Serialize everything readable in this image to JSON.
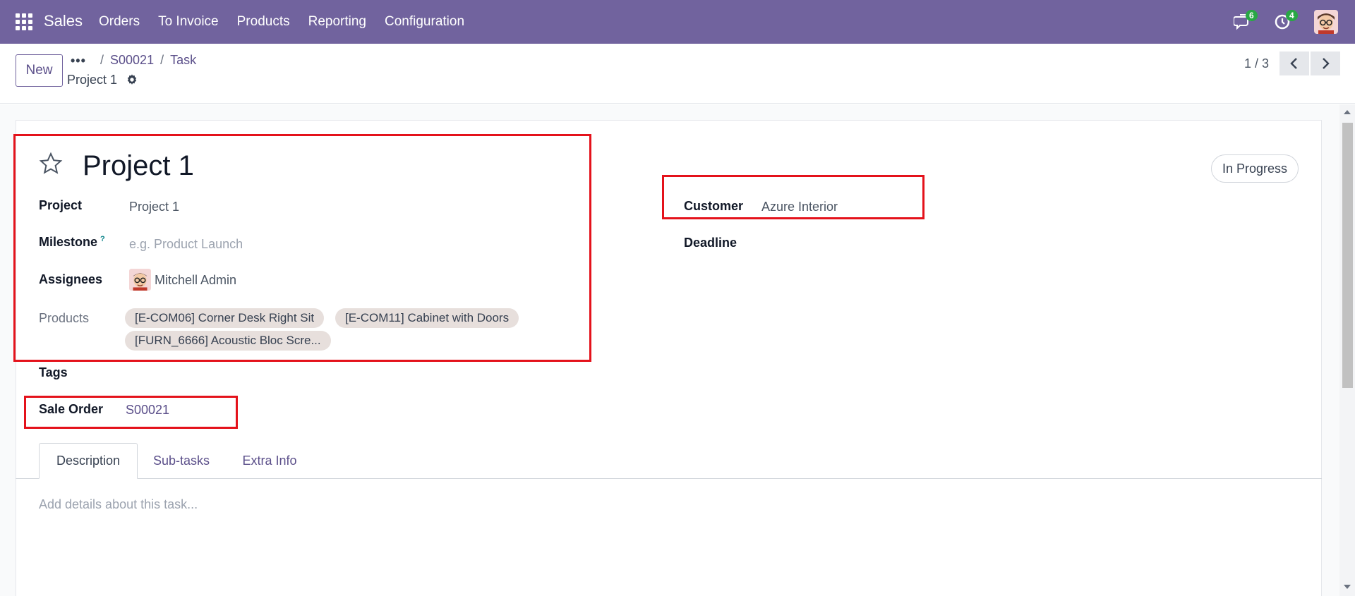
{
  "navbar": {
    "app_name": "Sales",
    "menu": [
      "Orders",
      "To Invoice",
      "Products",
      "Reporting",
      "Configuration"
    ],
    "messages_count": "6",
    "activities_count": "4",
    "background_color": "#71639e"
  },
  "control_panel": {
    "new_label": "New",
    "breadcrumb_more": "•••",
    "breadcrumbs": [
      "S00021",
      "Task"
    ],
    "record_title": "Project 1",
    "pager": "1 / 3"
  },
  "form": {
    "title": "Project 1",
    "status": "In Progress",
    "fields": {
      "project_label": "Project",
      "project_value": "Project 1",
      "milestone_label": "Milestone",
      "milestone_help": "?",
      "milestone_placeholder": "e.g. Product Launch",
      "assignees_label": "Assignees",
      "assignees_value": "Mitchell Admin",
      "products_label": "Products",
      "products": [
        "[E-COM06] Corner Desk Right Sit",
        "[E-COM11] Cabinet with Doors",
        "[FURN_6666] Acoustic Bloc Scre..."
      ],
      "tags_label": "Tags",
      "sale_order_label": "Sale Order",
      "sale_order_value": "S00021",
      "customer_label": "Customer",
      "customer_value": "Azure Interior",
      "deadline_label": "Deadline"
    },
    "tabs": [
      "Description",
      "Sub-tasks",
      "Extra Info"
    ],
    "active_tab": "Description",
    "description_placeholder": "Add details about this task..."
  },
  "colors": {
    "accent": "#71639e",
    "link": "#5b4f8a",
    "highlight": "#e4121b",
    "badge": "#28a745"
  }
}
